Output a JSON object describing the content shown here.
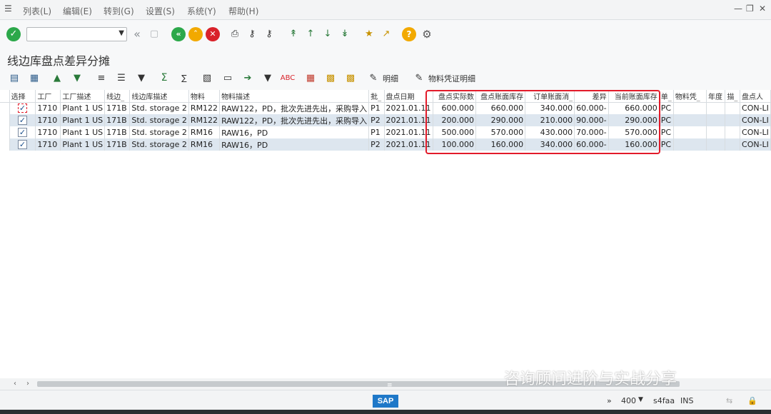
{
  "menubar": {
    "items": [
      "列表(L)",
      "编辑(E)",
      "转到(G)",
      "设置(S)",
      "系统(Y)",
      "帮助(H)"
    ]
  },
  "title": "线边库盘点差异分摊",
  "apptoolbar": {
    "detail_label": "明细",
    "mat_doc_detail_label": "物料凭证明细"
  },
  "grid": {
    "headers": [
      "选择",
      "工厂",
      "工厂描述",
      "线边_",
      "线边库描述",
      "物料",
      "物料描述",
      "批_",
      "盘点日期",
      "盘点实际数",
      "盘点账面库存",
      "订单账面消_",
      "差异",
      "当前账面库存",
      "单_",
      "物料凭_",
      "年度",
      "描_",
      "盘点人"
    ],
    "rows": [
      [
        "",
        "1710",
        "Plant 1 US",
        "171B",
        "Std. storage 2",
        "RM122",
        "RAW122，PD，批次先进先出，采购导入",
        "P1",
        "2021.01.11",
        "600.000",
        "660.000",
        "340.000",
        "60.000-",
        "660.000",
        "PC",
        "",
        "",
        "",
        "CON-LI"
      ],
      [
        "",
        "1710",
        "Plant 1 US",
        "171B",
        "Std. storage 2",
        "RM122",
        "RAW122，PD，批次先进先出，采购导入",
        "P2",
        "2021.01.11",
        "200.000",
        "290.000",
        "210.000",
        "90.000-",
        "290.000",
        "PC",
        "",
        "",
        "",
        "CON-LI"
      ],
      [
        "",
        "1710",
        "Plant 1 US",
        "171B",
        "Std. storage 2",
        "RM16",
        "RAW16，PD",
        "P1",
        "2021.01.11",
        "500.000",
        "570.000",
        "430.000",
        "70.000-",
        "570.000",
        "PC",
        "",
        "",
        "",
        "CON-LI"
      ],
      [
        "",
        "1710",
        "Plant 1 US",
        "171B",
        "Std. storage 2",
        "RM16",
        "RAW16，PD",
        "P2",
        "2021.01.11",
        "100.000",
        "160.000",
        "340.000",
        "60.000-",
        "160.000",
        "PC",
        "",
        "",
        "",
        "CON-LI"
      ]
    ]
  },
  "statusbar": {
    "logo": "SAP",
    "client": "400",
    "system": "s4faa",
    "mode": "INS",
    "arrows": "»"
  },
  "watermark": "咨询顾问进阶与实战分享"
}
